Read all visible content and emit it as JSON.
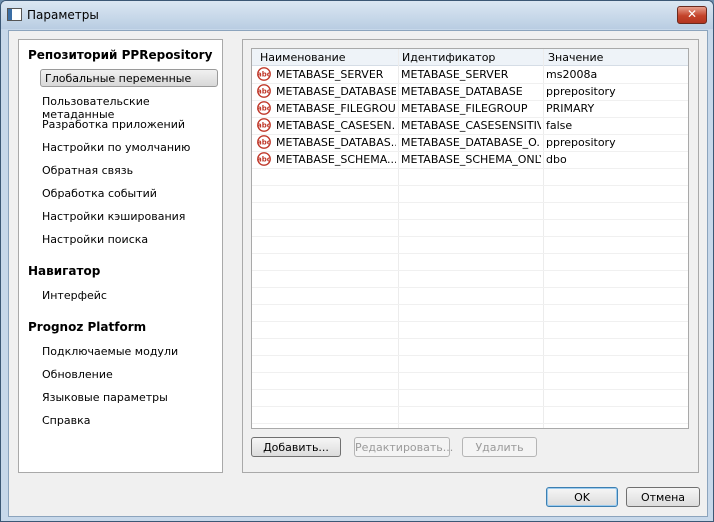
{
  "window": {
    "title": "Параметры",
    "close_glyph": "✕"
  },
  "sidebar": {
    "sections": [
      {
        "title": "Репозиторий PPRepository",
        "items": [
          "Глобальные переменные",
          "Пользовательские метаданные",
          "Разработка приложений",
          "Настройки по умолчанию",
          "Обратная связь",
          "Обработка событий",
          "Настройки кэширования",
          "Настройки поиска"
        ]
      },
      {
        "title": "Навигатор",
        "items": [
          "Интерфейс"
        ]
      },
      {
        "title": "Prognoz Platform",
        "items": [
          "Подключаемые модули",
          "Обновление",
          "Языковые параметры",
          "Справка"
        ]
      }
    ],
    "selected_item": "Глобальные переменные"
  },
  "table": {
    "columns": [
      "Наименование",
      "Идентификатор",
      "Значение"
    ],
    "rows": [
      {
        "name": "METABASE_SERVER",
        "id": "METABASE_SERVER",
        "value": "ms2008a"
      },
      {
        "name": "METABASE_DATABASE",
        "id": "METABASE_DATABASE",
        "value": "pprepository"
      },
      {
        "name": "METABASE_FILEGROUP",
        "id": "METABASE_FILEGROUP",
        "value": "PRIMARY"
      },
      {
        "name": "METABASE_CASESEN...",
        "id": "METABASE_CASESENSITIVE",
        "value": "false"
      },
      {
        "name": "METABASE_DATABAS...",
        "id": "METABASE_DATABASE_O...",
        "value": "pprepository"
      },
      {
        "name": "METABASE_SCHEMA...",
        "id": "METABASE_SCHEMA_ONLY",
        "value": "dbo"
      }
    ],
    "row_icon": "abc-text-icon",
    "icon_text": "abc"
  },
  "actions": {
    "add": "Добавить...",
    "edit": "Редактировать...",
    "delete": "Удалить"
  },
  "footer": {
    "ok": "OK",
    "cancel": "Отмена"
  },
  "colors": {
    "icon_red": "#c0392b"
  }
}
